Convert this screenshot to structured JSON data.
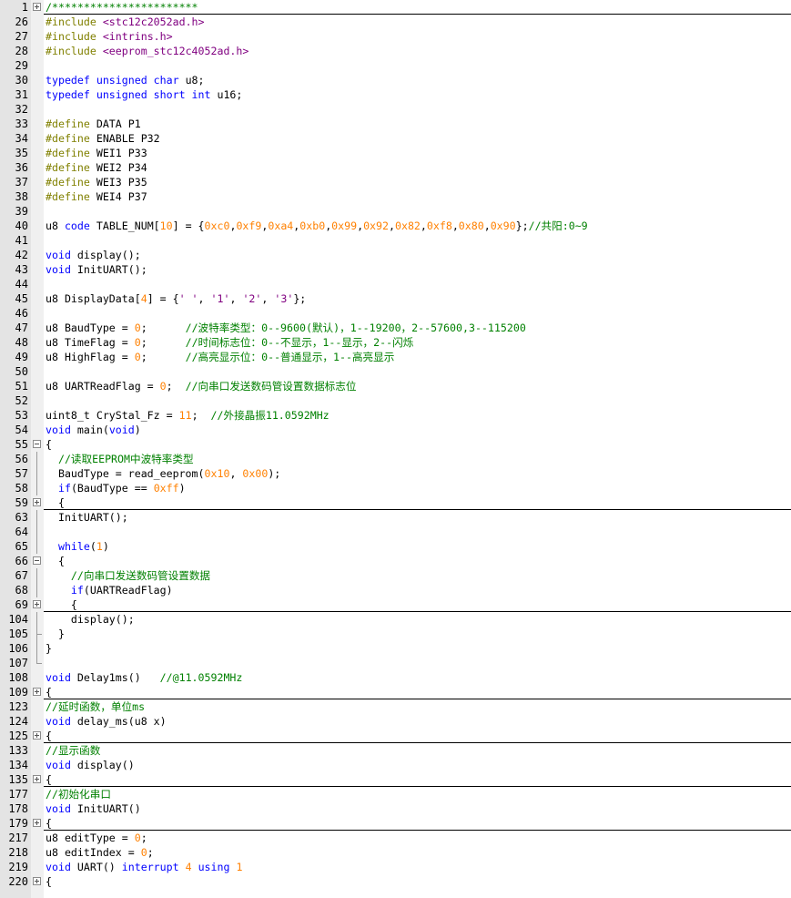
{
  "lines": [
    {
      "n": "1",
      "fold": "plus",
      "rule": true,
      "toks": [
        [
          "c",
          "/***********************"
        ]
      ]
    },
    {
      "n": "26",
      "toks": [
        [
          "p",
          "#include "
        ],
        [
          "s",
          "<stc12c2052ad.h>"
        ]
      ]
    },
    {
      "n": "27",
      "toks": [
        [
          "p",
          "#include "
        ],
        [
          "s",
          "<intrins.h>"
        ]
      ]
    },
    {
      "n": "28",
      "toks": [
        [
          "p",
          "#include "
        ],
        [
          "s",
          "<eeprom_stc12c4052ad.h>"
        ]
      ]
    },
    {
      "n": "29",
      "toks": []
    },
    {
      "n": "30",
      "toks": [
        [
          "k",
          "typedef unsigned char "
        ],
        [
          "x",
          "u8;"
        ]
      ]
    },
    {
      "n": "31",
      "toks": [
        [
          "k",
          "typedef unsigned short int "
        ],
        [
          "x",
          "u16;"
        ]
      ]
    },
    {
      "n": "32",
      "toks": []
    },
    {
      "n": "33",
      "toks": [
        [
          "p",
          "#define "
        ],
        [
          "x",
          "DATA P1"
        ]
      ]
    },
    {
      "n": "34",
      "toks": [
        [
          "p",
          "#define "
        ],
        [
          "x",
          "ENABLE P32"
        ]
      ]
    },
    {
      "n": "35",
      "toks": [
        [
          "p",
          "#define "
        ],
        [
          "x",
          "WEI1 P33"
        ]
      ]
    },
    {
      "n": "36",
      "toks": [
        [
          "p",
          "#define "
        ],
        [
          "x",
          "WEI2 P34"
        ]
      ]
    },
    {
      "n": "37",
      "toks": [
        [
          "p",
          "#define "
        ],
        [
          "x",
          "WEI3 P35"
        ]
      ]
    },
    {
      "n": "38",
      "toks": [
        [
          "p",
          "#define "
        ],
        [
          "x",
          "WEI4 P37"
        ]
      ]
    },
    {
      "n": "39",
      "toks": []
    },
    {
      "n": "40",
      "toks": [
        [
          "x",
          "u8 "
        ],
        [
          "k",
          "code "
        ],
        [
          "x",
          "TABLE_NUM["
        ],
        [
          "n",
          "10"
        ],
        [
          "x",
          "] = {"
        ],
        [
          "n",
          "0xc0"
        ],
        [
          "x",
          ","
        ],
        [
          "n",
          "0xf9"
        ],
        [
          "x",
          ","
        ],
        [
          "n",
          "0xa4"
        ],
        [
          "x",
          ","
        ],
        [
          "n",
          "0xb0"
        ],
        [
          "x",
          ","
        ],
        [
          "n",
          "0x99"
        ],
        [
          "x",
          ","
        ],
        [
          "n",
          "0x92"
        ],
        [
          "x",
          ","
        ],
        [
          "n",
          "0x82"
        ],
        [
          "x",
          ","
        ],
        [
          "n",
          "0xf8"
        ],
        [
          "x",
          ","
        ],
        [
          "n",
          "0x80"
        ],
        [
          "x",
          ","
        ],
        [
          "n",
          "0x90"
        ],
        [
          "x",
          "};"
        ],
        [
          "c",
          "//共阳:0~9"
        ]
      ]
    },
    {
      "n": "41",
      "toks": []
    },
    {
      "n": "42",
      "toks": [
        [
          "k",
          "void "
        ],
        [
          "x",
          "display();"
        ]
      ]
    },
    {
      "n": "43",
      "toks": [
        [
          "k",
          "void "
        ],
        [
          "x",
          "InitUART();"
        ]
      ]
    },
    {
      "n": "44",
      "toks": []
    },
    {
      "n": "45",
      "toks": [
        [
          "x",
          "u8 DisplayData["
        ],
        [
          "n",
          "4"
        ],
        [
          "x",
          "] = {"
        ],
        [
          "s",
          "' '"
        ],
        [
          "x",
          ", "
        ],
        [
          "s",
          "'1'"
        ],
        [
          "x",
          ", "
        ],
        [
          "s",
          "'2'"
        ],
        [
          "x",
          ", "
        ],
        [
          "s",
          "'3'"
        ],
        [
          "x",
          "};"
        ]
      ]
    },
    {
      "n": "46",
      "toks": []
    },
    {
      "n": "47",
      "toks": [
        [
          "x",
          "u8 BaudType = "
        ],
        [
          "n",
          "0"
        ],
        [
          "x",
          ";      "
        ],
        [
          "c",
          "//波特率类型：0--9600(默认)，1--19200，2--57600,3--115200"
        ]
      ]
    },
    {
      "n": "48",
      "toks": [
        [
          "x",
          "u8 TimeFlag = "
        ],
        [
          "n",
          "0"
        ],
        [
          "x",
          ";      "
        ],
        [
          "c",
          "//时间标志位：0--不显示，1--显示，2--闪烁"
        ]
      ]
    },
    {
      "n": "49",
      "toks": [
        [
          "x",
          "u8 HighFlag = "
        ],
        [
          "n",
          "0"
        ],
        [
          "x",
          ";      "
        ],
        [
          "c",
          "//高亮显示位：0--普通显示，1--高亮显示"
        ]
      ]
    },
    {
      "n": "50",
      "toks": []
    },
    {
      "n": "51",
      "toks": [
        [
          "x",
          "u8 UARTReadFlag = "
        ],
        [
          "n",
          "0"
        ],
        [
          "x",
          ";  "
        ],
        [
          "c",
          "//向串口发送数码管设置数据标志位"
        ]
      ]
    },
    {
      "n": "52",
      "toks": []
    },
    {
      "n": "53",
      "toks": [
        [
          "x",
          "uint8_t CryStal_Fz = "
        ],
        [
          "n",
          "11"
        ],
        [
          "x",
          ";  "
        ],
        [
          "c",
          "//外接晶振11.0592MHz"
        ]
      ]
    },
    {
      "n": "54",
      "toks": [
        [
          "k",
          "void "
        ],
        [
          "x",
          "main("
        ],
        [
          "k",
          "void"
        ],
        [
          "x",
          ")"
        ]
      ]
    },
    {
      "n": "55",
      "fold": "minus",
      "toks": [
        [
          "x",
          "{"
        ]
      ]
    },
    {
      "n": "56",
      "vl": true,
      "toks": [
        [
          "x",
          "  "
        ],
        [
          "c",
          "//读取EEPROM中波特率类型"
        ]
      ]
    },
    {
      "n": "57",
      "vl": true,
      "toks": [
        [
          "x",
          "  BaudType = read_eeprom("
        ],
        [
          "n",
          "0x10"
        ],
        [
          "x",
          ", "
        ],
        [
          "n",
          "0x00"
        ],
        [
          "x",
          ");"
        ]
      ]
    },
    {
      "n": "58",
      "vl": true,
      "toks": [
        [
          "x",
          "  "
        ],
        [
          "k",
          "if"
        ],
        [
          "x",
          "(BaudType == "
        ],
        [
          "n",
          "0xff"
        ],
        [
          "x",
          ")"
        ]
      ]
    },
    {
      "n": "59",
      "fold": "plus",
      "rule": true,
      "toks": [
        [
          "x",
          "  {"
        ]
      ]
    },
    {
      "n": "63",
      "vl": true,
      "toks": [
        [
          "x",
          "  InitUART();"
        ]
      ]
    },
    {
      "n": "64",
      "vl": true,
      "toks": []
    },
    {
      "n": "65",
      "vl": true,
      "toks": [
        [
          "x",
          "  "
        ],
        [
          "k",
          "while"
        ],
        [
          "x",
          "("
        ],
        [
          "n",
          "1"
        ],
        [
          "x",
          ")"
        ]
      ]
    },
    {
      "n": "66",
      "fold": "minus",
      "toks": [
        [
          "x",
          "  {"
        ]
      ]
    },
    {
      "n": "67",
      "vl": true,
      "toks": [
        [
          "x",
          "    "
        ],
        [
          "c",
          "//向串口发送数码管设置数据"
        ]
      ]
    },
    {
      "n": "68",
      "vl": true,
      "toks": [
        [
          "x",
          "    "
        ],
        [
          "k",
          "if"
        ],
        [
          "x",
          "(UARTReadFlag)"
        ]
      ]
    },
    {
      "n": "69",
      "fold": "plus",
      "rule": true,
      "toks": [
        [
          "x",
          "    {"
        ]
      ]
    },
    {
      "n": "104",
      "vl": true,
      "toks": [
        [
          "x",
          "    display();"
        ]
      ]
    },
    {
      "n": "105",
      "tick": true,
      "toks": [
        [
          "x",
          "  }"
        ]
      ]
    },
    {
      "n": "106",
      "vl": true,
      "toks": [
        [
          "x",
          "}"
        ]
      ]
    },
    {
      "n": "107",
      "end": true,
      "toks": []
    },
    {
      "n": "108",
      "toks": [
        [
          "k",
          "void "
        ],
        [
          "x",
          "Delay1ms()   "
        ],
        [
          "c",
          "//@11.0592MHz"
        ]
      ]
    },
    {
      "n": "109",
      "fold": "plus",
      "rule": true,
      "toks": [
        [
          "x",
          "{"
        ]
      ]
    },
    {
      "n": "123",
      "toks": [
        [
          "c",
          "//延时函数，单位ms"
        ]
      ]
    },
    {
      "n": "124",
      "toks": [
        [
          "k",
          "void "
        ],
        [
          "x",
          "delay_ms(u8 x)"
        ]
      ]
    },
    {
      "n": "125",
      "fold": "plus",
      "rule": true,
      "toks": [
        [
          "x",
          "{"
        ]
      ]
    },
    {
      "n": "133",
      "toks": [
        [
          "c",
          "//显示函数"
        ]
      ]
    },
    {
      "n": "134",
      "toks": [
        [
          "k",
          "void "
        ],
        [
          "x",
          "display()"
        ]
      ]
    },
    {
      "n": "135",
      "fold": "plus",
      "rule": true,
      "toks": [
        [
          "x",
          "{"
        ]
      ]
    },
    {
      "n": "177",
      "toks": [
        [
          "c",
          "//初始化串口"
        ]
      ]
    },
    {
      "n": "178",
      "toks": [
        [
          "k",
          "void "
        ],
        [
          "x",
          "InitUART()"
        ]
      ]
    },
    {
      "n": "179",
      "fold": "plus",
      "rule": true,
      "toks": [
        [
          "x",
          "{"
        ]
      ]
    },
    {
      "n": "217",
      "toks": [
        [
          "x",
          "u8 editType = "
        ],
        [
          "n",
          "0"
        ],
        [
          "x",
          ";"
        ]
      ]
    },
    {
      "n": "218",
      "toks": [
        [
          "x",
          "u8 editIndex = "
        ],
        [
          "n",
          "0"
        ],
        [
          "x",
          ";"
        ]
      ]
    },
    {
      "n": "219",
      "toks": [
        [
          "k",
          "void "
        ],
        [
          "x",
          "UART() "
        ],
        [
          "k",
          "interrupt "
        ],
        [
          "n",
          "4 "
        ],
        [
          "k",
          "using "
        ],
        [
          "n",
          "1"
        ]
      ]
    },
    {
      "n": "220",
      "fold": "plus",
      "toks": [
        [
          "x",
          "{"
        ]
      ]
    }
  ],
  "colors": {
    "preprocessor": "#808000",
    "keyword": "#0000ff",
    "comment": "#008000",
    "string": "#800080",
    "number": "#ff8000",
    "gutter": "#e4e4e4"
  }
}
